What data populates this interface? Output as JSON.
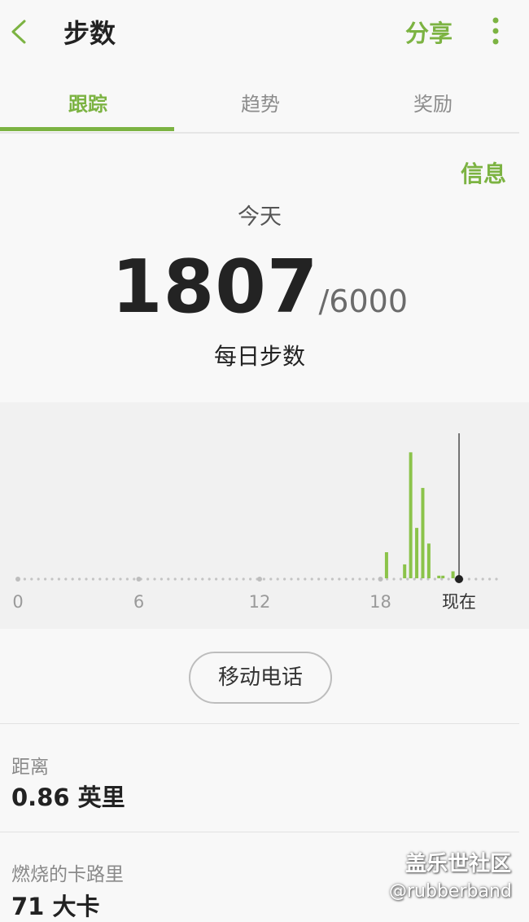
{
  "header": {
    "back_icon": "chevron-left-icon",
    "title": "步数",
    "share_label": "分享",
    "more_icon": "vertical-dots-icon"
  },
  "tabs": [
    {
      "label": "跟踪",
      "active": true
    },
    {
      "label": "趋势",
      "active": false
    },
    {
      "label": "奖励",
      "active": false
    }
  ],
  "info_label": "信息",
  "summary": {
    "day_label": "今天",
    "steps": "1807",
    "goal": "/6000",
    "caption": "每日步数"
  },
  "chart_data": {
    "type": "bar",
    "x_ticks": [
      "0",
      "6",
      "12",
      "18"
    ],
    "now_label": "现在",
    "xlim": [
      0,
      24
    ],
    "bars": [
      {
        "hour": 18.3,
        "value": 30
      },
      {
        "hour": 19.2,
        "value": 16
      },
      {
        "hour": 19.5,
        "value": 145
      },
      {
        "hour": 19.8,
        "value": 58
      },
      {
        "hour": 20.1,
        "value": 104
      },
      {
        "hour": 20.4,
        "value": 40
      },
      {
        "hour": 20.9,
        "value": 3
      },
      {
        "hour": 21.1,
        "value": 3
      },
      {
        "hour": 21.6,
        "value": 8
      }
    ],
    "now_hour": 21.9,
    "colors": {
      "bar": "#8bc34a",
      "axis_dots": "#c4c4c4",
      "now_line": "#222222"
    }
  },
  "device_button": "移动电话",
  "stats": [
    {
      "label": "距离",
      "value": "0.86 英里"
    },
    {
      "label": "燃烧的卡路里",
      "value": "71 大卡"
    }
  ],
  "watermark": {
    "line1": "盖乐世社区",
    "line2": "@rubberband"
  },
  "colors": {
    "accent": "#7cb342",
    "background": "#f8f8f8",
    "chart_bg": "#f1f1f1"
  }
}
